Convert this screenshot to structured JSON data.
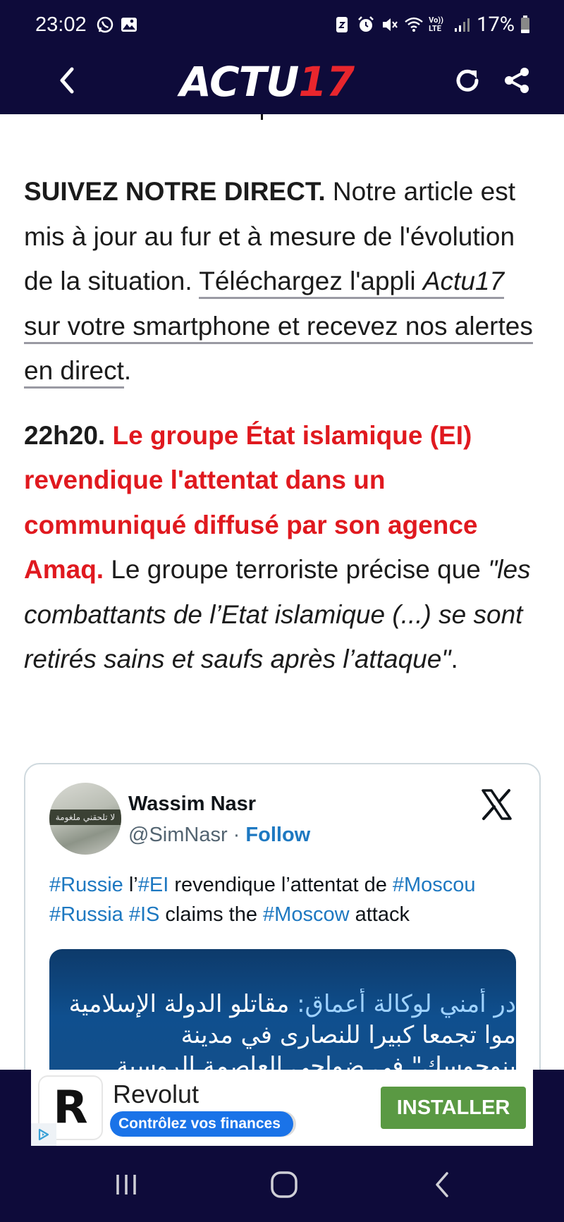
{
  "status_bar": {
    "time": "23:02",
    "battery": "17%",
    "left_icons": [
      "whatsapp-icon",
      "gallery-icon"
    ],
    "right_icons": [
      "dnd-icon",
      "alarm-icon",
      "mute-icon",
      "wifi-icon",
      "volte-icon",
      "signal-icon",
      "battery-icon"
    ],
    "volte_label": "Vo)) LTE"
  },
  "app_bar": {
    "logo_part1": "ACTU",
    "logo_part2": "17",
    "colors": {
      "background": "#0e0b3a",
      "logo_white": "#ffffff",
      "logo_red": "#e8262d"
    }
  },
  "article": {
    "p1_bold": "SUIVEZ NOTRE DIRECT.",
    "p1_text": " Notre article est mis à jour au fur et à mesure de l'évolution de la situation. ",
    "p1_link_a": "Téléchargez l'appli ",
    "p1_link_italic": "Actu17",
    "p1_link_b": " sur votre smartphone et recevez nos alertes en direct",
    "p1_end": ".",
    "p2_time": "22h20.",
    "p2_red": " Le groupe État islamique (EI) revendique l'attentat dans un communiqué diffusé par son agence Amaq.",
    "p2_text": " Le groupe terroriste précise que ",
    "p2_quote": "\"les combattants de l’Etat islamique (...) se sont retirés sains et saufs après l’attaque\"",
    "p2_end": ".",
    "colors": {
      "accent_red": "#e0191f",
      "text": "#1b1b1b"
    }
  },
  "tweet": {
    "name": "Wassim Nasr",
    "handle": "@SimNasr",
    "separator": " · ",
    "follow": "Follow",
    "avatar_caption": "لا تلحقني ملغومة",
    "text_parts": [
      {
        "t": "#Russie",
        "tag": true
      },
      {
        "t": " l’",
        "tag": false
      },
      {
        "t": "#EI",
        "tag": true
      },
      {
        "t": " revendique l’attentat de ",
        "tag": false
      },
      {
        "t": "#Moscou",
        "tag": true
      },
      {
        "t": " ",
        "tag": false
      },
      {
        "t": "#Russia",
        "tag": true
      },
      {
        "t": " ",
        "tag": false
      },
      {
        "t": "#IS",
        "tag": true
      },
      {
        "t": " claims the ",
        "tag": false
      },
      {
        "t": "#Moscow",
        "tag": true
      },
      {
        "t": " attack",
        "tag": false
      }
    ],
    "media_line1_a": "در أمني لوكالة أعماق: ",
    "media_line1_b": "مقاتلو الدولة الإسلامية",
    "media_line2": "موا تجمعا كبيرا للنصارى في مدينة",
    "media_line3": "بنوجوسك\" في ضواحي العاصمة الروسية",
    "colors": {
      "hashtag": "#1d78c1"
    }
  },
  "ad": {
    "logo_letter": "R",
    "title": "Revolut",
    "subtitle": "Contrôlez vos finances",
    "cta": "INSTALLER",
    "colors": {
      "cta": "#5a9943",
      "subtitle_bg": "#1a73e8"
    }
  },
  "nav_bar": {
    "icons": [
      "recent-apps-icon",
      "home-icon",
      "back-icon"
    ]
  }
}
